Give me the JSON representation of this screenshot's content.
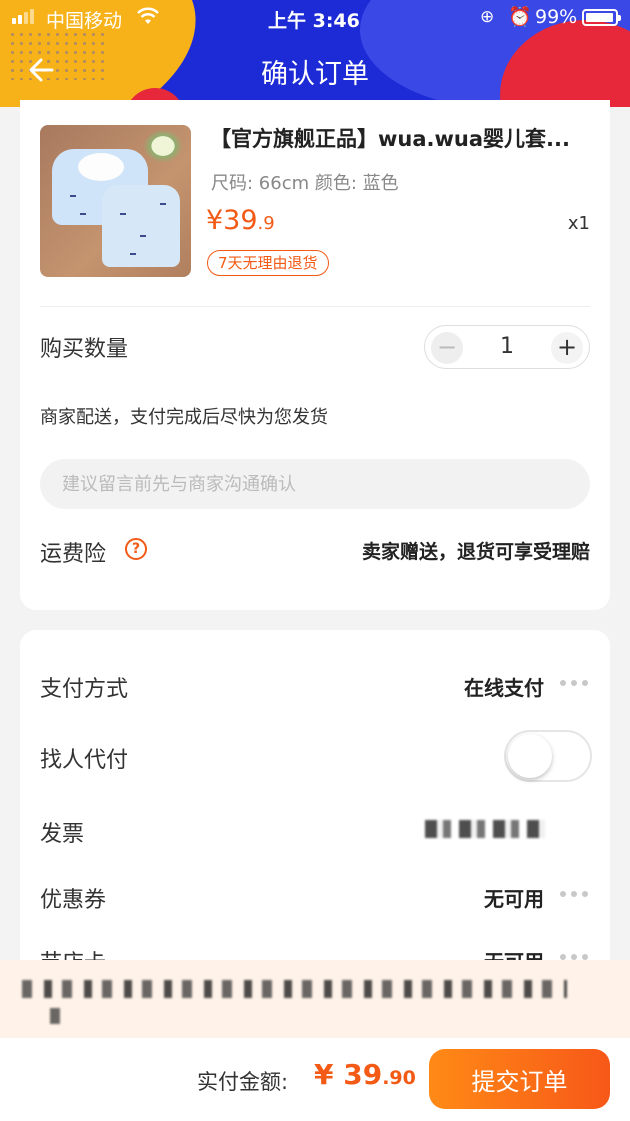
{
  "status_bar": {
    "carrier": "中国移动",
    "time": "上午 3:46",
    "battery": "99%"
  },
  "header": {
    "title": "确认订单",
    "back_icon": "back-arrow-icon"
  },
  "product": {
    "title": "【官方旗舰正品】wua.wua婴儿套...",
    "spec": "尺码: 66cm 颜色: 蓝色",
    "price_main": "¥39",
    "price_decimal": ".9",
    "quantity_mark": "x1",
    "tag": "7天无理由退货"
  },
  "order": {
    "quantity_label": "购买数量",
    "quantity_value": "1",
    "minus": "−",
    "plus": "+",
    "delivery_text": "商家配送，支付完成后尽快为您发货",
    "note_placeholder": "建议留言前先与商家沟通确认",
    "note_value": "",
    "insurance_label": "运费险",
    "insurance_value": "卖家赠送，退货可享受理赔"
  },
  "payment": {
    "method_label": "支付方式",
    "method_value": "在线支付",
    "proxy_label": "找人代付",
    "proxy_enabled": false,
    "invoice_label": "发票",
    "coupon_label": "优惠券",
    "coupon_value": "无可用",
    "giftcard_label": "节店卡",
    "giftcard_value": "无可用"
  },
  "footer": {
    "total_label": "实付金额:",
    "total_main": "¥ 39",
    "total_decimal": ".90",
    "submit_label": "提交订单"
  },
  "colors": {
    "accent": "#f25a15",
    "header_blue": "#1d2bd6",
    "yellow": "#f7b21a",
    "red": "#e6283a"
  }
}
